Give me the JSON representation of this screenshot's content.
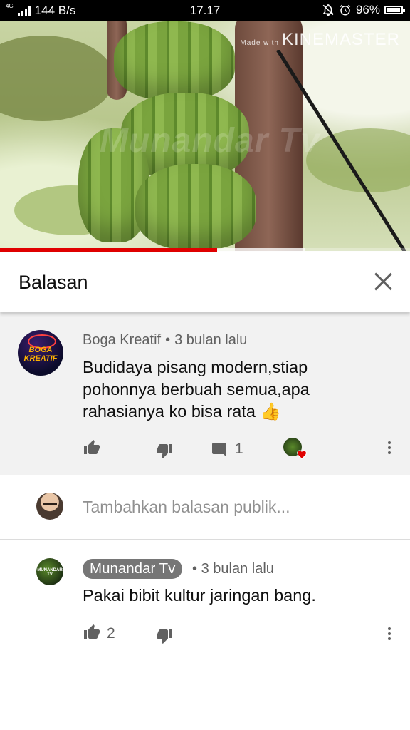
{
  "status_bar": {
    "network": "4G",
    "speed": "144 B/s",
    "time": "17.17",
    "battery": "96%"
  },
  "video": {
    "watermark_prefix": "Made with",
    "watermark": "KINEMASTER",
    "overlay": "Munandar Tv",
    "progress_played": 0.53,
    "progress_buffered": 0.745
  },
  "panel": {
    "title": "Balasan",
    "close_icon": "close-icon"
  },
  "main_comment": {
    "author": "Boga Kreatif",
    "avatar_text": "BOGA KREATIF",
    "separator": "•",
    "time": "3 bulan lalu",
    "text": "Budidaya pisang modern,stiap pohonnya berbuah semua,apa rahasianya ko bisa rata 👍",
    "reply_count": "1"
  },
  "reply_box": {
    "placeholder": "Tambahkan balasan publik..."
  },
  "reply": {
    "author": "Munandar Tv",
    "avatar_text": "MUNANDAR TV",
    "separator": "•",
    "time": "3 bulan lalu",
    "text": "Pakai bibit kultur jaringan bang.",
    "like_count": "2"
  },
  "colors": {
    "accent_red": "#e00000",
    "panel_bg": "#f2f2f2",
    "icon_gray": "#606060"
  }
}
